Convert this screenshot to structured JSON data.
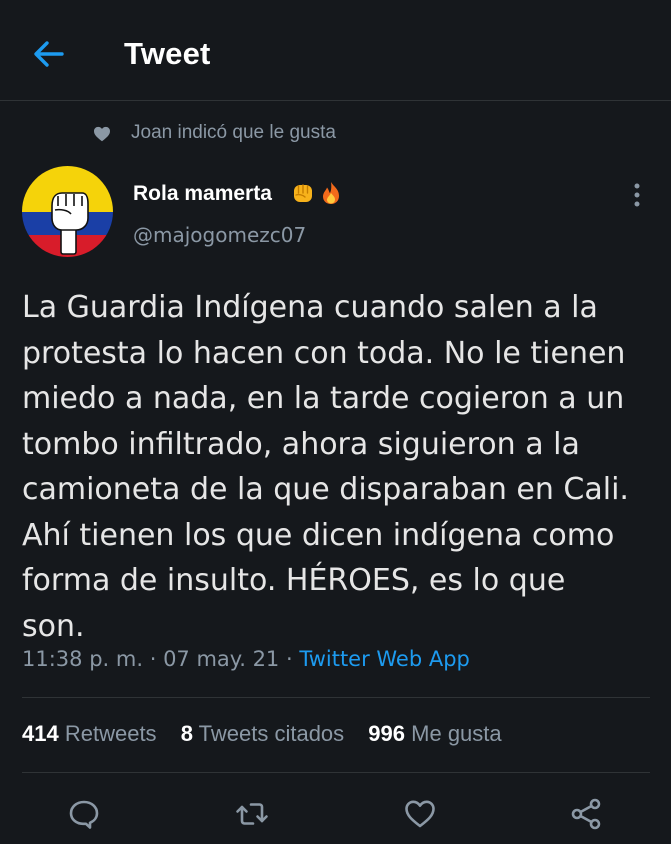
{
  "header": {
    "title": "Tweet",
    "back_icon": "arrow-left-icon"
  },
  "social_context": {
    "text": "Joan indicó que le gusta",
    "icon": "heart-filled-icon"
  },
  "author": {
    "display_name": "Rola mamerta",
    "handle": "@majogomezc07",
    "emojis": [
      "raised-fist-emoji",
      "fire-emoji"
    ],
    "avatar": "colombian-flag-fist-avatar"
  },
  "tweet": {
    "text": "La Guardia Indígena cuando salen a la\nprotesta lo hacen con toda. No le tienen\nmiedo a nada, en la tarde cogieron a un\ntombo infiltrado, ahora siguieron a la\ncamioneta de la que disparaban en Cali.\nAhí tienen los que dicen indígena como\nforma de insulto. HÉROES, es lo que\nson.",
    "time": "11:38 p. m.",
    "date": "07 may. 21",
    "source": "Twitter Web App"
  },
  "stats": {
    "retweets": {
      "count": "414",
      "label": "Retweets"
    },
    "quotes": {
      "count": "8",
      "label": "Tweets citados"
    },
    "likes": {
      "count": "996",
      "label": "Me gusta"
    }
  },
  "actions": [
    "reply-icon",
    "retweet-icon",
    "like-icon",
    "share-icon"
  ],
  "colors": {
    "background": "#15181c",
    "accent": "#1d9bf0",
    "secondary_text": "#8b98a5",
    "divider": "#2f3336"
  }
}
